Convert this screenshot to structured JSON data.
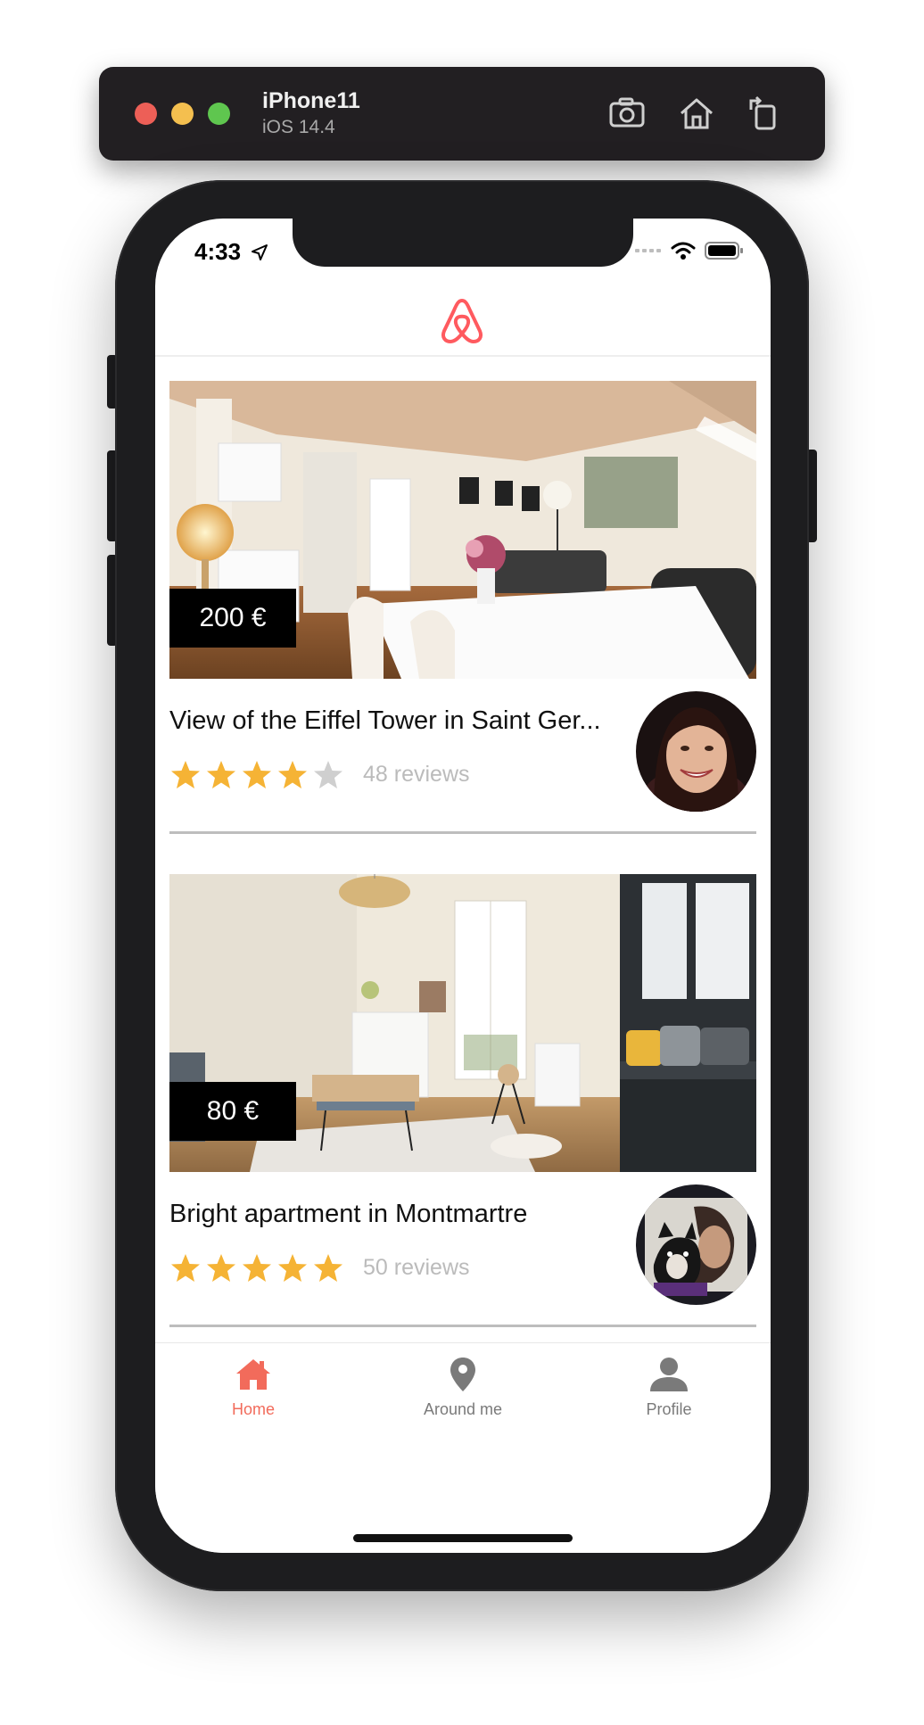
{
  "simulator": {
    "device_name": "iPhone11",
    "os_version": "iOS 14.4"
  },
  "status_bar": {
    "time": "4:33"
  },
  "listings": [
    {
      "price": "200 €",
      "title": "View of the Eiffel Tower in Saint Ger...",
      "rating": 4,
      "max_rating": 5,
      "reviews": "48 reviews"
    },
    {
      "price": "80 €",
      "title": "Bright apartment in Montmartre",
      "rating": 5,
      "max_rating": 5,
      "reviews": "50 reviews"
    }
  ],
  "tabs": [
    {
      "label": "Home",
      "icon": "home-icon",
      "active": true
    },
    {
      "label": "Around me",
      "icon": "location-pin-icon",
      "active": false
    },
    {
      "label": "Profile",
      "icon": "user-icon",
      "active": false
    }
  ],
  "colors": {
    "brand": "#ff5a5f",
    "tab_active": "#f26b5b",
    "tab_inactive": "#7a7a7a",
    "star_filled": "#f5b335",
    "star_empty": "#cfcfcf"
  }
}
